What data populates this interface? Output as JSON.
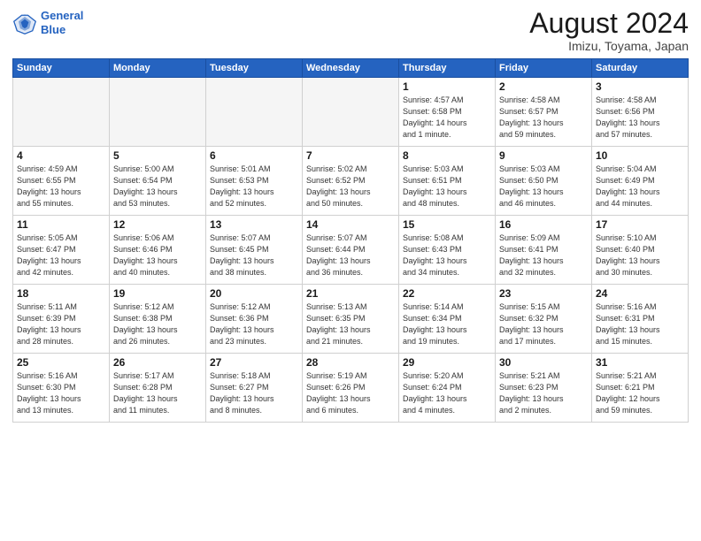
{
  "logo": {
    "line1": "General",
    "line2": "Blue"
  },
  "title": "August 2024",
  "location": "Imizu, Toyama, Japan",
  "days_of_week": [
    "Sunday",
    "Monday",
    "Tuesday",
    "Wednesday",
    "Thursday",
    "Friday",
    "Saturday"
  ],
  "weeks": [
    [
      {
        "day": "",
        "info": ""
      },
      {
        "day": "",
        "info": ""
      },
      {
        "day": "",
        "info": ""
      },
      {
        "day": "",
        "info": ""
      },
      {
        "day": "1",
        "info": "Sunrise: 4:57 AM\nSunset: 6:58 PM\nDaylight: 14 hours\nand 1 minute."
      },
      {
        "day": "2",
        "info": "Sunrise: 4:58 AM\nSunset: 6:57 PM\nDaylight: 13 hours\nand 59 minutes."
      },
      {
        "day": "3",
        "info": "Sunrise: 4:58 AM\nSunset: 6:56 PM\nDaylight: 13 hours\nand 57 minutes."
      }
    ],
    [
      {
        "day": "4",
        "info": "Sunrise: 4:59 AM\nSunset: 6:55 PM\nDaylight: 13 hours\nand 55 minutes."
      },
      {
        "day": "5",
        "info": "Sunrise: 5:00 AM\nSunset: 6:54 PM\nDaylight: 13 hours\nand 53 minutes."
      },
      {
        "day": "6",
        "info": "Sunrise: 5:01 AM\nSunset: 6:53 PM\nDaylight: 13 hours\nand 52 minutes."
      },
      {
        "day": "7",
        "info": "Sunrise: 5:02 AM\nSunset: 6:52 PM\nDaylight: 13 hours\nand 50 minutes."
      },
      {
        "day": "8",
        "info": "Sunrise: 5:03 AM\nSunset: 6:51 PM\nDaylight: 13 hours\nand 48 minutes."
      },
      {
        "day": "9",
        "info": "Sunrise: 5:03 AM\nSunset: 6:50 PM\nDaylight: 13 hours\nand 46 minutes."
      },
      {
        "day": "10",
        "info": "Sunrise: 5:04 AM\nSunset: 6:49 PM\nDaylight: 13 hours\nand 44 minutes."
      }
    ],
    [
      {
        "day": "11",
        "info": "Sunrise: 5:05 AM\nSunset: 6:47 PM\nDaylight: 13 hours\nand 42 minutes."
      },
      {
        "day": "12",
        "info": "Sunrise: 5:06 AM\nSunset: 6:46 PM\nDaylight: 13 hours\nand 40 minutes."
      },
      {
        "day": "13",
        "info": "Sunrise: 5:07 AM\nSunset: 6:45 PM\nDaylight: 13 hours\nand 38 minutes."
      },
      {
        "day": "14",
        "info": "Sunrise: 5:07 AM\nSunset: 6:44 PM\nDaylight: 13 hours\nand 36 minutes."
      },
      {
        "day": "15",
        "info": "Sunrise: 5:08 AM\nSunset: 6:43 PM\nDaylight: 13 hours\nand 34 minutes."
      },
      {
        "day": "16",
        "info": "Sunrise: 5:09 AM\nSunset: 6:41 PM\nDaylight: 13 hours\nand 32 minutes."
      },
      {
        "day": "17",
        "info": "Sunrise: 5:10 AM\nSunset: 6:40 PM\nDaylight: 13 hours\nand 30 minutes."
      }
    ],
    [
      {
        "day": "18",
        "info": "Sunrise: 5:11 AM\nSunset: 6:39 PM\nDaylight: 13 hours\nand 28 minutes."
      },
      {
        "day": "19",
        "info": "Sunrise: 5:12 AM\nSunset: 6:38 PM\nDaylight: 13 hours\nand 26 minutes."
      },
      {
        "day": "20",
        "info": "Sunrise: 5:12 AM\nSunset: 6:36 PM\nDaylight: 13 hours\nand 23 minutes."
      },
      {
        "day": "21",
        "info": "Sunrise: 5:13 AM\nSunset: 6:35 PM\nDaylight: 13 hours\nand 21 minutes."
      },
      {
        "day": "22",
        "info": "Sunrise: 5:14 AM\nSunset: 6:34 PM\nDaylight: 13 hours\nand 19 minutes."
      },
      {
        "day": "23",
        "info": "Sunrise: 5:15 AM\nSunset: 6:32 PM\nDaylight: 13 hours\nand 17 minutes."
      },
      {
        "day": "24",
        "info": "Sunrise: 5:16 AM\nSunset: 6:31 PM\nDaylight: 13 hours\nand 15 minutes."
      }
    ],
    [
      {
        "day": "25",
        "info": "Sunrise: 5:16 AM\nSunset: 6:30 PM\nDaylight: 13 hours\nand 13 minutes."
      },
      {
        "day": "26",
        "info": "Sunrise: 5:17 AM\nSunset: 6:28 PM\nDaylight: 13 hours\nand 11 minutes."
      },
      {
        "day": "27",
        "info": "Sunrise: 5:18 AM\nSunset: 6:27 PM\nDaylight: 13 hours\nand 8 minutes."
      },
      {
        "day": "28",
        "info": "Sunrise: 5:19 AM\nSunset: 6:26 PM\nDaylight: 13 hours\nand 6 minutes."
      },
      {
        "day": "29",
        "info": "Sunrise: 5:20 AM\nSunset: 6:24 PM\nDaylight: 13 hours\nand 4 minutes."
      },
      {
        "day": "30",
        "info": "Sunrise: 5:21 AM\nSunset: 6:23 PM\nDaylight: 13 hours\nand 2 minutes."
      },
      {
        "day": "31",
        "info": "Sunrise: 5:21 AM\nSunset: 6:21 PM\nDaylight: 12 hours\nand 59 minutes."
      }
    ]
  ]
}
